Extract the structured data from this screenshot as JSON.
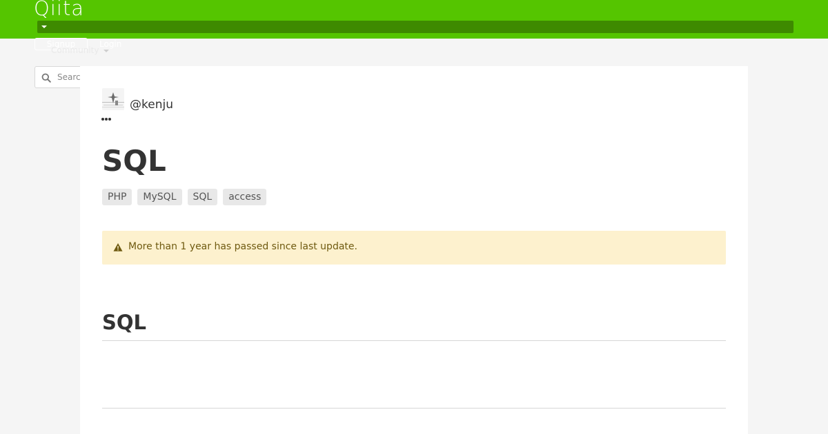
{
  "header": {
    "logo": "Qiita",
    "signup_label": "Signup",
    "login_label": "Login",
    "community_label": "Community",
    "brand_color": "#55c500"
  },
  "search": {
    "placeholder": "Search"
  },
  "article": {
    "author": "@kenju",
    "title": "SQL",
    "tags": [
      "PHP",
      "MySQL",
      "SQL",
      "access"
    ],
    "notice": "More than 1 year has passed since last update.",
    "sections": [
      {
        "heading": "SQL"
      }
    ]
  },
  "icons": {
    "search": "search-icon",
    "warning": "warning-icon",
    "more": "more-dots-icon",
    "caret": "caret-down-icon"
  }
}
